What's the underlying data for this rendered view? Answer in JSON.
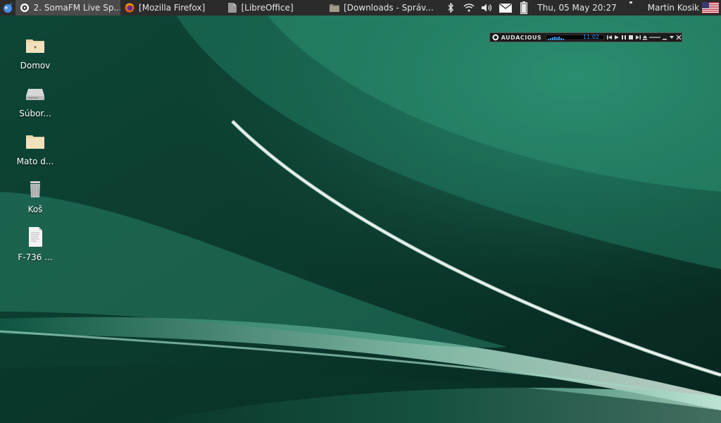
{
  "panel": {
    "tasks": [
      {
        "label": "2. SomaFM Live Sp...",
        "icon": "audacious-icon",
        "active": true
      },
      {
        "label": "[Mozilla Firefox]",
        "icon": "firefox-icon",
        "active": false
      },
      {
        "label": "[LibreOffice]",
        "icon": "document-icon",
        "active": false
      },
      {
        "label": "[Downloads - Správ...",
        "icon": "folder-icon",
        "active": false
      }
    ],
    "clock": "Thu, 05 May  20:27",
    "user": "Martin Kosik",
    "tray_icons": [
      "bluetooth-icon",
      "wifi-icon",
      "volume-icon",
      "mail-icon",
      "battery-icon"
    ]
  },
  "desktop": {
    "icons": [
      {
        "label": "Domov",
        "icon": "home-folder-icon"
      },
      {
        "label": "Súbor...",
        "icon": "drive-icon"
      },
      {
        "label": "Mato d...",
        "icon": "folder-icon"
      },
      {
        "label": "Koš",
        "icon": "trash-icon"
      },
      {
        "label": "F-736 ...",
        "icon": "document-icon"
      }
    ]
  },
  "audacious": {
    "title": "AUDACIOUS",
    "time": "11:02"
  },
  "colors": {
    "panel_bg": "#2b2b2b",
    "wallpaper_base": "#0a3a2e",
    "wallpaper_accent": "#2f8f73"
  }
}
